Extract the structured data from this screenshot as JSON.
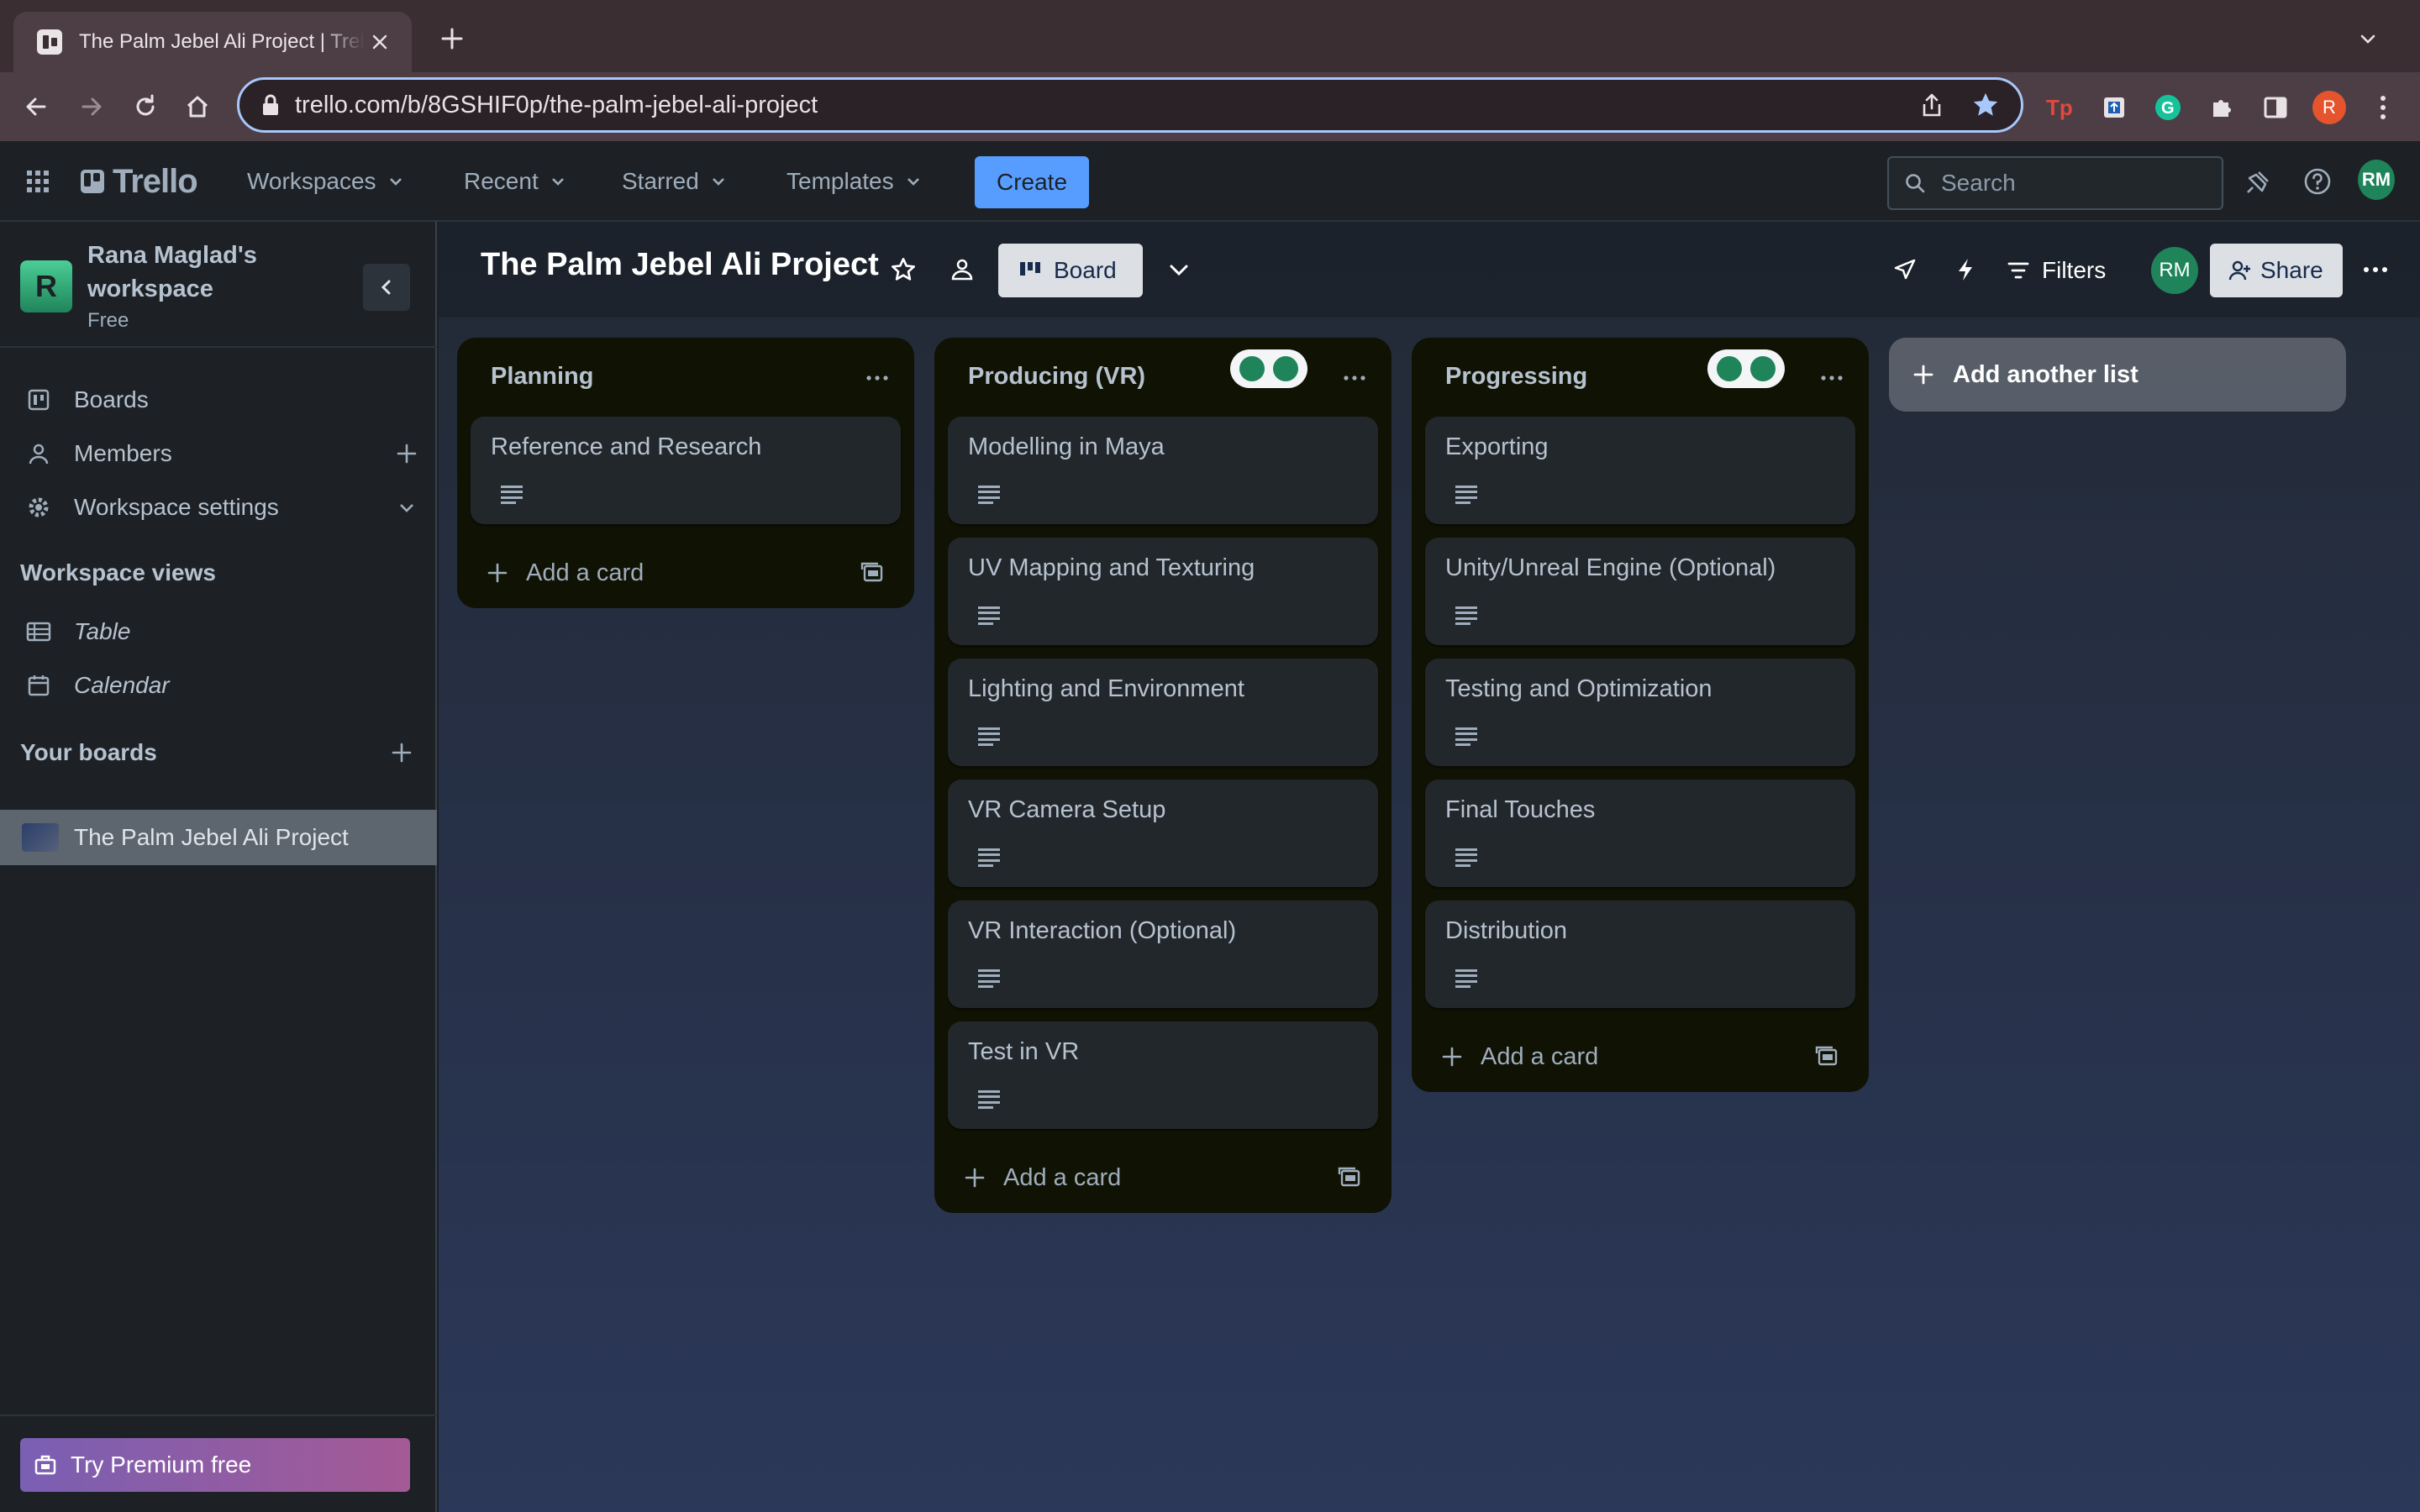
{
  "browser": {
    "tab_title": "The Palm Jebel Ali Project | Trello",
    "url": "trello.com/b/8GSHIF0p/the-palm-jebel-ali-project",
    "profile_initial": "R"
  },
  "header": {
    "logo": "Trello",
    "menus": [
      "Workspaces",
      "Recent",
      "Starred",
      "Templates"
    ],
    "create_label": "Create",
    "search_placeholder": "Search",
    "user_initials": "RM"
  },
  "sidebar": {
    "workspace_name": "Rana Maglad's workspace",
    "workspace_badge": "R",
    "plan": "Free",
    "nav": [
      {
        "label": "Boards"
      },
      {
        "label": "Members"
      },
      {
        "label": "Workspace settings"
      }
    ],
    "views_heading": "Workspace views",
    "views": [
      {
        "label": "Table"
      },
      {
        "label": "Calendar"
      }
    ],
    "boards_heading": "Your boards",
    "boards": [
      {
        "label": "The Palm Jebel Ali Project"
      }
    ],
    "premium_label": "Try Premium free"
  },
  "board": {
    "title": "The Palm Jebel Ali Project",
    "view_label": "Board",
    "filters_label": "Filters",
    "member_initials": "RM",
    "share_label": "Share",
    "add_list_label": "Add another list",
    "lists": [
      {
        "title": "Planning",
        "cards": [
          "Reference and Research"
        ],
        "add_label": "Add a card"
      },
      {
        "title": "Producing (VR)",
        "cards": [
          "Modelling in Maya",
          "UV Mapping and Texturing",
          "Lighting and Environment",
          "VR Camera Setup",
          "VR Interaction (Optional)",
          "Test in VR"
        ],
        "add_label": "Add a card"
      },
      {
        "title": "Progressing",
        "cards": [
          "Exporting",
          "Unity/Unreal Engine (Optional)",
          "Testing and Optimization",
          "Final Touches",
          "Distribution"
        ],
        "add_label": "Add a card"
      }
    ]
  },
  "colors": {
    "accent": "#579dff",
    "avatar": "#1f845a",
    "header_bg": "#1d2125",
    "card_bg": "#22272b",
    "list_bg": "#101204"
  }
}
